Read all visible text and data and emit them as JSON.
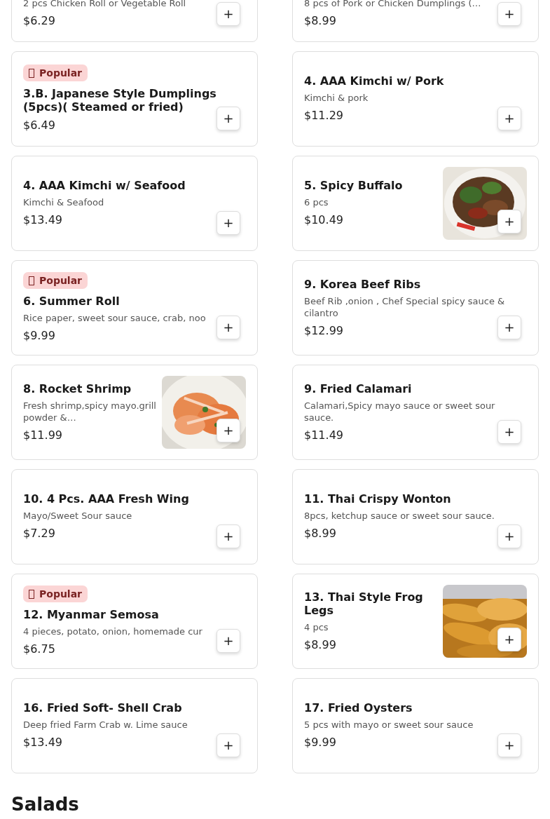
{
  "menu_items": [
    {
      "description": "2 pcs Chicken Roll or Vegetable Roll",
      "price": "$6.29",
      "add_button": "+"
    },
    {
      "description": "8 pcs of Pork or Chicken Dumplings (…",
      "price": "$8.99",
      "add_button": "+"
    },
    {
      "badge": {
        "label": "Popular"
      },
      "title": "3.B. Japanese Style Dumplings (5pcs)( Steamed or fried)",
      "price": "$6.49",
      "add_button": "+"
    },
    {
      "title": "4. AAA Kimchi w/ Pork",
      "description": "Kimchi & pork",
      "price": "$11.29",
      "add_button": "+"
    },
    {
      "title": "4. AAA Kimchi w/ Seafood",
      "description": "Kimchi & Seafood",
      "price": "$13.49",
      "add_button": "+"
    },
    {
      "title": "5. Spicy Buffalo",
      "description": "6 pcs",
      "price": "$10.49",
      "add_button": "+"
    },
    {
      "badge": {
        "label": "Popular"
      },
      "title": "6. Summer Roll",
      "description": "Rice paper, sweet sour sauce, crab, noo",
      "price": "$9.99",
      "add_button": "+"
    },
    {
      "title": "9. Korea Beef Ribs",
      "description": "Beef Rib ,onion , Chef Special spicy sauce & cilantro",
      "price": "$12.99",
      "add_button": "+"
    },
    {
      "title": "8. Rocket Shrimp",
      "description": "Fresh shrimp,spicy mayo.grill powder &…",
      "price": "$11.99",
      "add_button": "+"
    },
    {
      "title": "9. Fried Calamari",
      "description": "Calamari,Spicy mayo sauce or sweet sour sauce.",
      "price": "$11.49",
      "add_button": "+"
    },
    {
      "title": "10. 4 Pcs. AAA Fresh Wing",
      "description": "Mayo/Sweet Sour sauce",
      "price": "$7.29",
      "add_button": "+"
    },
    {
      "title": "11. Thai Crispy Wonton",
      "description": "8pcs, ketchup sauce or sweet sour sauce.",
      "price": "$8.99",
      "add_button": "+"
    },
    {
      "badge": {
        "label": "Popular"
      },
      "title": "12. Myanmar Semosa",
      "description": "4 pieces, potato, onion, homemade cur",
      "price": "$6.75",
      "add_button": "+"
    },
    {
      "title": "13. Thai Style Frog Legs",
      "description": "4 pcs",
      "price": "$8.99",
      "add_button": "+"
    },
    {
      "title": "16. Fried Soft- Shell Crab",
      "description": "Deep fried Farm Crab w. Lime sauce",
      "price": "$13.49",
      "add_button": "+"
    },
    {
      "title": "17. Fried Oysters",
      "description": "5 pcs with mayo or sweet sour sauce",
      "price": "$9.99",
      "add_button": "+"
    }
  ],
  "next_section": {
    "heading": "Salads"
  }
}
